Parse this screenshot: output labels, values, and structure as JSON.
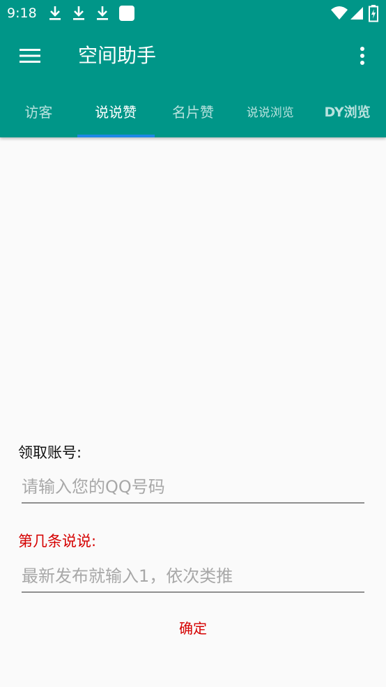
{
  "status_bar": {
    "time": "9:18",
    "notification_icons": [
      "download-icon",
      "download-icon",
      "download-icon",
      "app-square-icon"
    ],
    "system_icons": [
      "wifi-icon",
      "cellular-signal-icon",
      "battery-charging-icon"
    ]
  },
  "toolbar": {
    "title": "空间助手",
    "menu_icon": "hamburger-menu-icon",
    "overflow_icon": "more-vertical-icon"
  },
  "tabs": [
    {
      "label": "访客",
      "active": false
    },
    {
      "label": "说说赞",
      "active": true
    },
    {
      "label": "名片赞",
      "active": false
    },
    {
      "label": "说说浏览",
      "active": false
    },
    {
      "label": "DY浏览",
      "active": false
    }
  ],
  "form": {
    "account_label": "领取账号:",
    "account_placeholder": "请输入您的QQ号码",
    "account_value": "",
    "index_label": "第几条说说:",
    "index_placeholder": "最新发布就输入1，依次类推",
    "index_value": "",
    "confirm_label": "确定"
  },
  "colors": {
    "primary": "#009688",
    "indicator": "#1e88e5",
    "accent_red": "#d50000",
    "background": "#fafafa"
  }
}
